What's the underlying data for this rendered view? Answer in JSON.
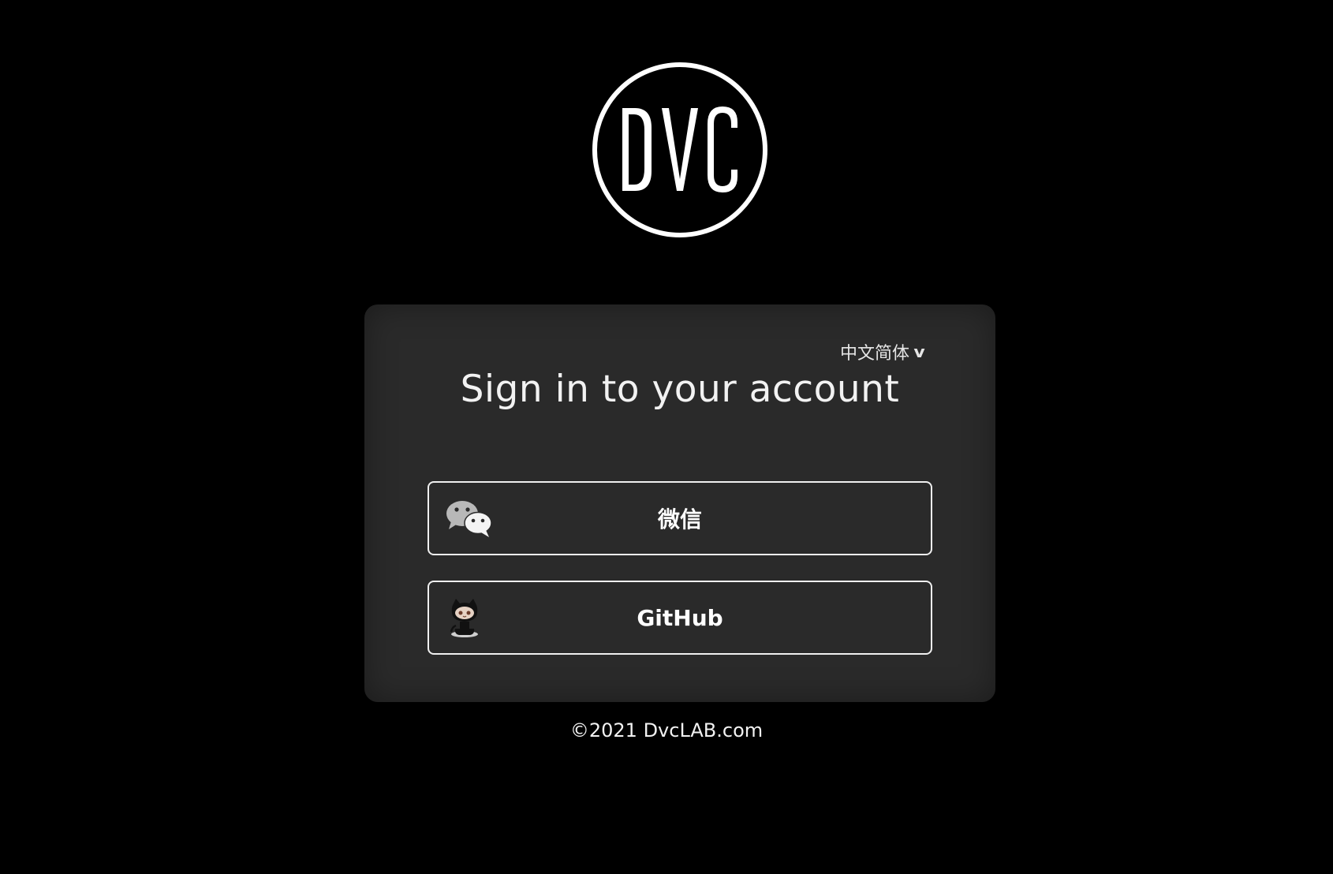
{
  "logo": {
    "text": "DVC"
  },
  "card": {
    "language": {
      "selected": "中文简体",
      "chevron": "v"
    },
    "title": "Sign in to your account",
    "buttons": [
      {
        "label": "微信",
        "icon": "wechat-icon"
      },
      {
        "label": "GitHub",
        "icon": "github-icon"
      }
    ]
  },
  "footer": {
    "copyright": "©2021 DvcLAB.com"
  },
  "colors": {
    "background": "#000000",
    "card": "#2a2a2a",
    "text": "#f2f2f2",
    "border": "#f0f0f0"
  }
}
